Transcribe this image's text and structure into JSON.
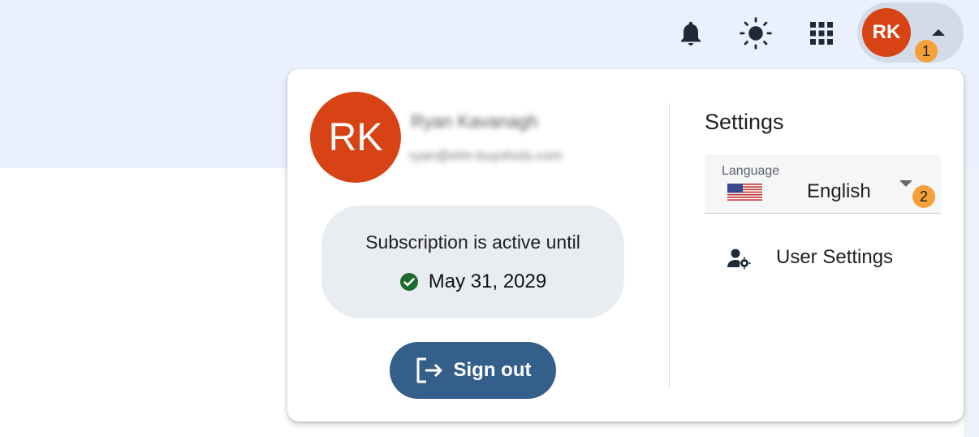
{
  "toolbar": {
    "bell_icon": "bell-icon",
    "theme_icon": "sun-icon",
    "apps_icon": "apps-grid-icon"
  },
  "account": {
    "initials": "RK",
    "step_badge": "1"
  },
  "profile": {
    "initials": "RK",
    "name": "Ryan Kavanagh",
    "email": "ryan@elm-buyshots.com"
  },
  "subscription": {
    "status_text": "Subscription is active until",
    "date": "May 31, 2029"
  },
  "actions": {
    "sign_out_label": "Sign out"
  },
  "settings": {
    "title": "Settings",
    "language": {
      "label": "Language",
      "value": "English",
      "step_badge": "2"
    },
    "user_settings_label": "User Settings"
  },
  "colors": {
    "avatar": "#d84315",
    "sign_out": "#355f8b",
    "badge": "#f6a03a",
    "header_bg": "#eaf1fd"
  }
}
